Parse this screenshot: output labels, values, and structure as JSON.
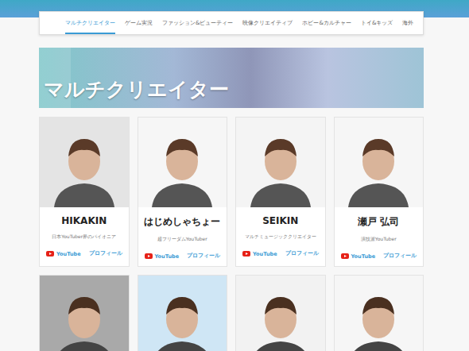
{
  "nav": {
    "tabs": [
      {
        "label": "マルチクリエイター",
        "selected": true
      },
      {
        "label": "ゲーム実況",
        "selected": false
      },
      {
        "label": "ファッション&ビューティー",
        "selected": false
      },
      {
        "label": "映像クリエイティブ",
        "selected": false
      },
      {
        "label": "ホビー&カルチャー",
        "selected": false
      },
      {
        "label": "トイ&キッズ",
        "selected": false
      },
      {
        "label": "海外",
        "selected": false
      }
    ]
  },
  "banner": {
    "title": "マルチクリエイター"
  },
  "cards": [
    {
      "name": "HIKAKIN",
      "description": "日本YouTuber界のパイオニア",
      "youtube_label": "YouTube",
      "profile_label": "プロフィール",
      "color": "#e4e4e4"
    },
    {
      "name": "はじめしゃちょー",
      "description": "超フリーダムYouTuber",
      "youtube_label": "YouTube",
      "profile_label": "プロフィール",
      "color": "#f6f6f6"
    },
    {
      "name": "SEIKIN",
      "description": "マルチミュージッククリエイター",
      "youtube_label": "YouTube",
      "profile_label": "プロフィール",
      "color": "#f4f4f4"
    },
    {
      "name": "瀬戸 弘司",
      "description": "演技派YouTuber",
      "youtube_label": "YouTube",
      "profile_label": "プロフィール",
      "color": "#f6f6f6"
    }
  ],
  "partial_cards": [
    {
      "color": "#a9a9a9"
    },
    {
      "color": "#cfe6f5"
    },
    {
      "color": "#f2f2f2"
    },
    {
      "color": "#f6f6f6"
    }
  ]
}
